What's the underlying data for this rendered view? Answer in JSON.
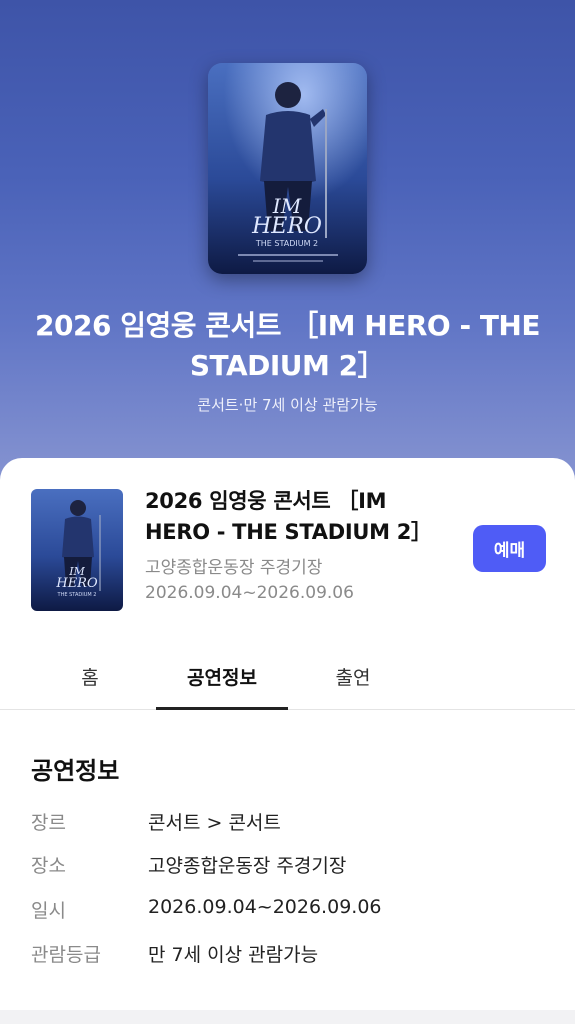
{
  "hero": {
    "title": "2026 임영웅 콘서트 ［IM HERO - THE STADIUM 2］",
    "subtitle": "콘서트·만 7세 이상 관람가능"
  },
  "poster": {
    "title_line1": "IM",
    "title_line2": "HERO",
    "subtitle": "THE STADIUM 2"
  },
  "event": {
    "title": "2026 임영웅 콘서트 ［IM HERO - THE STADIUM 2］",
    "venue": "고양종합운동장 주경기장",
    "dates": "2026.09.04~2026.09.06",
    "reserve_label": "예매"
  },
  "tabs": [
    {
      "label": "홈",
      "active": false
    },
    {
      "label": "공연정보",
      "active": true
    },
    {
      "label": "출연",
      "active": false
    }
  ],
  "info": {
    "section_title": "공연정보",
    "rows": [
      {
        "key": "장르",
        "value": "콘서트 > 콘서트"
      },
      {
        "key": "장소",
        "value": "고양종합운동장 주경기장"
      },
      {
        "key": "일시",
        "value": "2026.09.04~2026.09.06"
      },
      {
        "key": "관람등급",
        "value": "만 7세 이상 관람가능"
      }
    ]
  },
  "colors": {
    "accent": "#4f5cf6",
    "hero_top": "#3e54a8",
    "hero_bottom": "#8a97d2"
  }
}
